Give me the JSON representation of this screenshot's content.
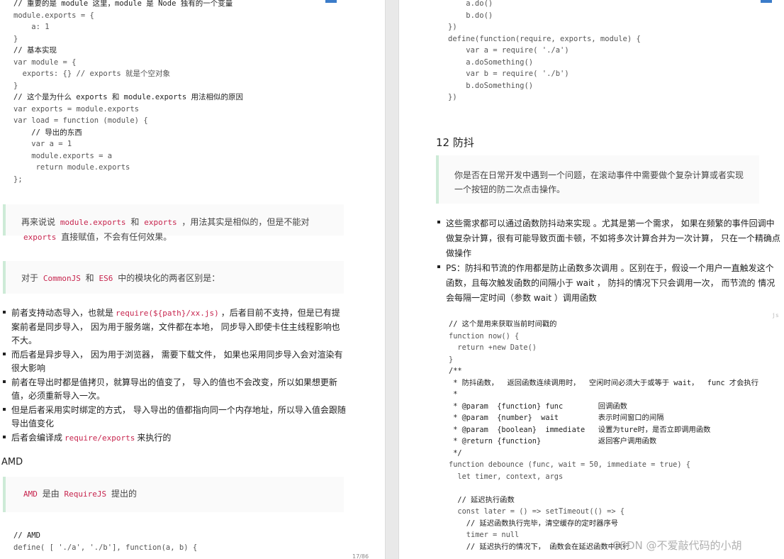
{
  "left": {
    "code1_lines": [
      "// 重要的是 module 这里，module 是 Node 独有的一个变量",
      "module.exports = {",
      "    a: 1",
      "}",
      "// 基本实现",
      "var module = {",
      "  exports: {} // exports 就是个空对象",
      "}",
      "// 这个是为什么 exports 和 module.exports 用法相似的原因",
      "var exports = module.exports",
      "var load = function (module) {",
      "    // 导出的东西",
      "    var a = 1",
      "    module.exports = a",
      "     return module.exports",
      "};"
    ],
    "quote1": {
      "pre": "再来说说",
      "code1": "module.exports",
      "mid1": "和",
      "code2": "exports",
      "post1": "，用法其实是相似的，但是不能对",
      "code3": "exports",
      "post2": "直接赋值，不会有任何效果。"
    },
    "quote2": {
      "pre": "对于",
      "code1": "CommonJS",
      "mid": "和",
      "code2": "ES6",
      "post": "中的模块化的两者区别是："
    },
    "bullets": [
      {
        "pre": "前者支持动态导入，也就是",
        "code": "require(${path}/xx.js)",
        "post": "，后者目前不支持，但是已有提案前者是同步导入，  因为用于服务端，文件都在本地，  同步导入即使卡住主线程影响也不大。"
      },
      {
        "pre": "而后者是异步导入，  因为用于浏览器，  需要下载文件，  如果也采用同步导入会对渲染有很大影响",
        "code": "",
        "post": ""
      },
      {
        "pre": "前者在导出时都是值拷贝，就算导出的值变了，  导入的值也不会改变，所以如果想更新值，必须重新导入一次。",
        "code": "",
        "post": ""
      },
      {
        "pre": "但是后者采用实时绑定的方式，  导入导出的值都指向同一个内存地址，所以导入值会跟随导出值变化",
        "code": "",
        "post": ""
      },
      {
        "pre": "后者会编译成",
        "code": "require/exports",
        "post": "来执行的"
      }
    ],
    "amd_heading": "AMD",
    "quote3": {
      "code1": "AMD",
      "mid": "是由",
      "code2": "RequireJS",
      "post": "提出的"
    },
    "code2_lines": [
      "// AMD",
      "define( [ './a', './b'], function(a, b) {"
    ],
    "page_footer": "17/86"
  },
  "right": {
    "code_top_lines": [
      "    a.do()",
      "    b.do()",
      "})",
      "define(function(require, exports, module) {",
      "    var a = require( './a')",
      "    a.doSomething()",
      "    var b = require( './b')",
      "    b.doSomething()",
      "})"
    ],
    "heading": "12 防抖",
    "quote": "你是否在日常开发中遇到一个问题，在滚动事件中需要做个复杂计算或者实现一个按钮的防二次点击操作。",
    "bullets": [
      {
        "text": "这些需求都可以通过函数防抖动来实现 。尤其是第一个需求，  如果在频繁的事件回调中做复杂计算，很有可能导致页面卡顿，不如将多次计算合并为一次计算，  只在一个精确点做操作"
      },
      {
        "text": "PS：防抖和节流的作用都是防止函数多次调用 。区别在于，假设一个用户一直触发这个函数，且每次触发函数的间隔小于 wait ，  防抖的情况下只会调用一次，  而节流的 情况会每隔一定时间（参数 wait ）调用函数"
      }
    ],
    "code_lang": "js",
    "code_lines": [
      "// 这个是用来获取当前时间戳的",
      "function now() {",
      "  return +new Date()",
      "}",
      "/**",
      " * 防抖函数，  返回函数连续调用时，  空闲时间必须大于或等于 wait，  func 才会执行",
      " *",
      " * @param  {function} func        回调函数",
      " * @param  {number}  wait         表示时间窗口的间隔",
      " * @param  {boolean}  immediate   设置为ture时，是否立即调用函数",
      " * @return {function}             返回客户调用函数",
      " */",
      "function debounce (func, wait = 50, immediate = true) {",
      "  let timer, context, args",
      "",
      "  // 延迟执行函数",
      "  const later = () => setTimeout(() => {",
      "    // 延迟函数执行完毕，清空缓存的定时器序号",
      "    timer = null",
      "    // 延迟执行的情况下， 函数会在延迟函数中执行"
    ],
    "watermark": "CSDN @不爱敲代码的小胡"
  }
}
